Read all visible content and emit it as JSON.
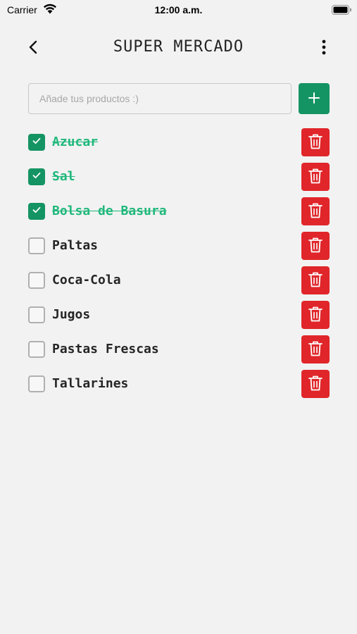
{
  "status_bar": {
    "carrier": "Carrier",
    "time": "12:00 a.m."
  },
  "header": {
    "title": "SUPER MERCADO",
    "back_icon": "chevron-left-icon",
    "menu_icon": "more-vertical-icon"
  },
  "add_form": {
    "placeholder": "Añade tus productos :)",
    "value": "",
    "add_icon": "plus-icon"
  },
  "colors": {
    "accent": "#149463",
    "done_text": "#1fb87b",
    "delete": "#e0262a",
    "background": "#f2f2f2"
  },
  "items": [
    {
      "label": "Azucar",
      "checked": true
    },
    {
      "label": "Sal",
      "checked": true
    },
    {
      "label": "Bolsa de Basura",
      "checked": true
    },
    {
      "label": "Paltas",
      "checked": false
    },
    {
      "label": "Coca-Cola",
      "checked": false
    },
    {
      "label": "Jugos",
      "checked": false
    },
    {
      "label": "Pastas Frescas",
      "checked": false
    },
    {
      "label": "Tallarines",
      "checked": false
    }
  ]
}
